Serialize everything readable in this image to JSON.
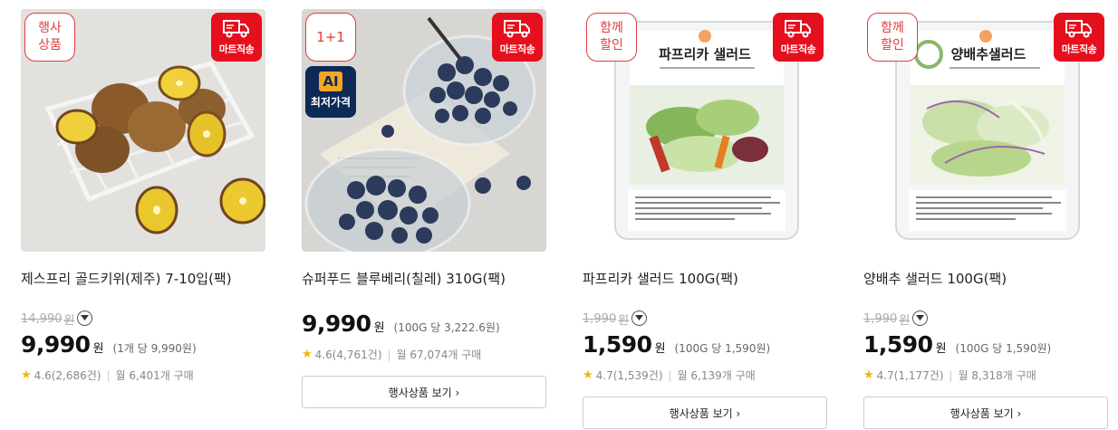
{
  "products": [
    {
      "badge_left": "행사\n상품",
      "badge_mart": "마트직송",
      "title": "제스프리 골드키위(제주) 7-10입(팩)",
      "original_price": "14,990",
      "original_won": "원",
      "price": "9,990",
      "won": "원",
      "unit_price": "(1개 당 9,990원)",
      "rating": "4.6(2,686건)",
      "monthly": "월 6,401개 구매",
      "promo_button": ""
    },
    {
      "badge_left": "1+1",
      "badge_ai_top": "AI",
      "badge_ai_bottom": "최저가격",
      "badge_mart": "마트직송",
      "title": "슈퍼푸드 블루베리(칠레) 310G(팩)",
      "price": "9,990",
      "won": "원",
      "unit_price": "(100G 당 3,222.6원)",
      "rating": "4.6(4,761건)",
      "monthly": "월 67,074개 구매",
      "promo_button": "행사상품 보기 ›"
    },
    {
      "badge_left": "함께\n할인",
      "badge_mart": "마트직송",
      "package_label": "파프리카 샐러드",
      "title": "파프리카 샐러드 100G(팩)",
      "original_price": "1,990",
      "original_won": "원",
      "price": "1,590",
      "won": "원",
      "unit_price": "(100G 당 1,590원)",
      "rating": "4.7(1,539건)",
      "monthly": "월 6,139개 구매",
      "promo_button": "행사상품 보기 ›"
    },
    {
      "badge_left": "함께\n할인",
      "badge_mart": "마트직송",
      "package_label": "양배추샐러드",
      "title": "양배추 샐러드 100G(팩)",
      "original_price": "1,990",
      "original_won": "원",
      "price": "1,590",
      "won": "원",
      "unit_price": "(100G 당 1,590원)",
      "rating": "4.7(1,177건)",
      "monthly": "월 8,318개 구매",
      "promo_button": "행사상품 보기 ›"
    }
  ],
  "colors": {
    "accent_red": "#e60f1e",
    "badge_outline": "#e23c3c",
    "ai_navy": "#0c2a55",
    "star": "#f6b400"
  },
  "icons": [
    "truck-icon",
    "star-icon",
    "chevron-down-icon"
  ]
}
